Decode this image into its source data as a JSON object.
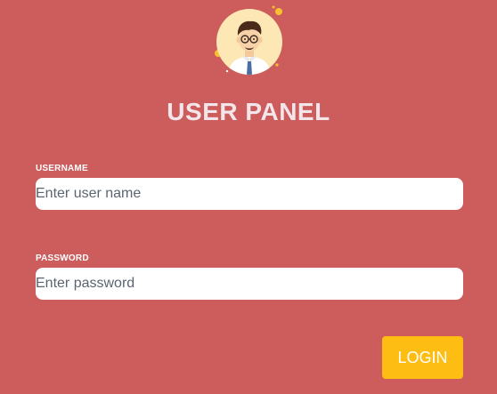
{
  "panel": {
    "title": "USER PANEL"
  },
  "avatar": {
    "icon": "user-avatar-icon"
  },
  "form": {
    "username": {
      "label": "USERNAME",
      "placeholder": "Enter user name",
      "value": ""
    },
    "password": {
      "label": "PASSWORD",
      "placeholder": "Enter password",
      "value": ""
    },
    "login_label": "LOGIN"
  },
  "colors": {
    "background": "#cd5c5c",
    "button": "#fdbd13",
    "avatar_bg": "#fde7b4"
  }
}
